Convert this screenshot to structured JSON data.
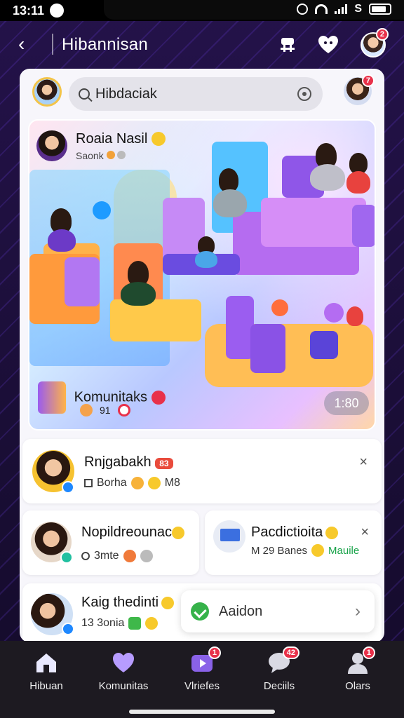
{
  "status": {
    "time": "13:11",
    "carrier": "S"
  },
  "header": {
    "title": "Hibannisan",
    "profile_badge": "2"
  },
  "search": {
    "value": "Hibdaciak",
    "right_badge": "7"
  },
  "hero": {
    "author": "Roaia Nasil",
    "subtitle": "Saonk",
    "community_label": "Komunitaks",
    "duration": "1:80",
    "foot_text": "91"
  },
  "cards": [
    {
      "title": "Rnjgabakh",
      "tag": "83",
      "meta": "Borha",
      "meta_extra": "M8",
      "action": "×"
    },
    {
      "title": "Nopildreounac",
      "meta": "3mte"
    },
    {
      "title": "Pacdictioita",
      "meta": "M 29 Banes",
      "meta_extra": "Mauile",
      "action": "×"
    },
    {
      "title": "Kaig thedinti",
      "meta": "13 3onia"
    }
  ],
  "add_card": {
    "label": "Aaidon"
  },
  "nav": [
    {
      "label": "Hibuan",
      "icon": "home-icon",
      "badge": ""
    },
    {
      "label": "Komunitas",
      "icon": "community-icon",
      "badge": ""
    },
    {
      "label": "Vlriefes",
      "icon": "video-icon",
      "badge": "1"
    },
    {
      "label": "Deciils",
      "icon": "chat-icon",
      "badge": "42"
    },
    {
      "label": "Olars",
      "icon": "profile-icon",
      "badge": "1"
    }
  ],
  "colors": {
    "accent": "#e8314a",
    "brand": "#6b3fd4",
    "background": "#1b0f33"
  }
}
